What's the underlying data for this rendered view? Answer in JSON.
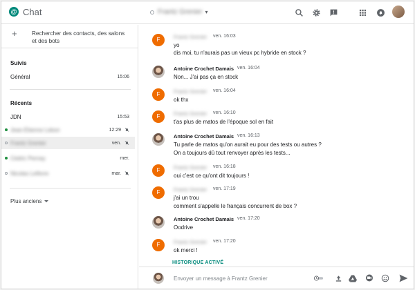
{
  "app": {
    "title": "Chat",
    "logo_glyph": "@"
  },
  "header": {
    "room_name": "Frantz Grenier",
    "caret": "▾"
  },
  "sidebar": {
    "search_label": "Rechercher des contacts, des salons et des bots",
    "sections": {
      "suivis": "Suivis",
      "recents": "Récents"
    },
    "suivis_items": [
      {
        "name": "Général",
        "time": "15:06"
      }
    ],
    "recent_items": [
      {
        "name": "JDN",
        "time": "15:53",
        "presence": "none",
        "muted": false
      },
      {
        "name": "Jean-Étienne Lebon",
        "time": "12:29",
        "presence": "on",
        "muted": true
      },
      {
        "name": "Frantz Grenier",
        "time": "ven.",
        "presence": "off",
        "muted": true
      },
      {
        "name": "Cédric Pernay",
        "time": "mer.",
        "presence": "on",
        "muted": false
      },
      {
        "name": "Nicolas Lefèvre",
        "time": "mar.",
        "presence": "off",
        "muted": true
      }
    ],
    "more_label": "Plus anciens"
  },
  "messages": [
    {
      "avatar": "F",
      "sender": "Frantz Grenier",
      "time": "ven. 16:03",
      "lines": [
        "yo",
        "dis moi, tu n'aurais pas un vieux pc hybride en stock ?"
      ]
    },
    {
      "avatar": "photo",
      "sender": "Antoine Crochet Damais",
      "time": "ven. 16:04",
      "lines": [
        "Non... J'ai pas ça en stock"
      ]
    },
    {
      "avatar": "F",
      "sender": "Frantz Grenier",
      "time": "ven. 16:04",
      "lines": [
        "ok thx"
      ]
    },
    {
      "avatar": "F",
      "sender": "Frantz Grenier",
      "time": "ven. 16:10",
      "lines": [
        "t'as plus de matos de l'époque sol en fait"
      ]
    },
    {
      "avatar": "photo",
      "sender": "Antoine Crochet Damais",
      "time": "ven. 16:13",
      "lines": [
        "Tu parle de matos qu'on aurait eu pour des tests ou autres ?",
        "On a toujours dû tout renvoyer après les tests..."
      ]
    },
    {
      "avatar": "F",
      "sender": "Frantz Grenier",
      "time": "ven. 16:18",
      "lines": [
        "oui c'est ce qu'ont dit toujours !"
      ]
    },
    {
      "avatar": "F",
      "sender": "Frantz Grenier",
      "time": "ven. 17:19",
      "lines": [
        "j'ai un trou",
        "comment s'appelle le français concurrent de box ?"
      ]
    },
    {
      "avatar": "photo",
      "sender": "Antoine Crochet Damais",
      "time": "ven. 17:20",
      "lines": [
        "Oodrive"
      ]
    },
    {
      "avatar": "F",
      "sender": "Frantz Grenier",
      "time": "ven. 17:20",
      "lines": [
        "ok merci !"
      ]
    }
  ],
  "history_label": "HISTORIQUE ACTIVÉ",
  "compose": {
    "placeholder": "Envoyer un message à Frantz Grenier"
  },
  "colors": {
    "accent": "#00897b",
    "avatar_orange": "#ef6c00",
    "presence_green": "#1e8e3e"
  },
  "icons": {
    "header": [
      "search-icon",
      "gear-icon",
      "feedback-icon",
      "apps-grid-icon",
      "notification-icon"
    ],
    "compose": [
      "history-toggle-icon",
      "upload-icon",
      "drive-icon",
      "meet-icon",
      "emoji-icon",
      "send-icon"
    ]
  }
}
